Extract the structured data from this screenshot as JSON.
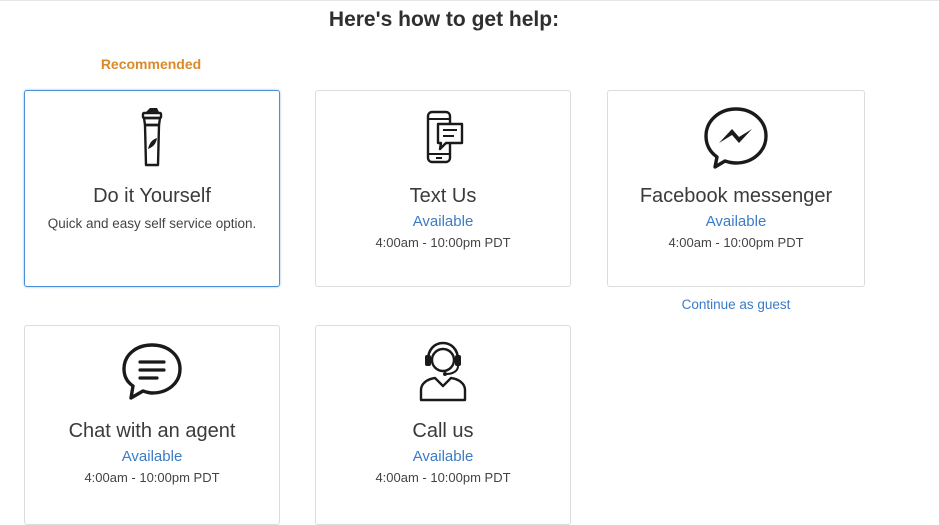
{
  "page": {
    "heading": "Here's how to get help:",
    "recommended_label": "Recommended"
  },
  "options": [
    {
      "title": "Do it Yourself",
      "description": "Quick and easy self service option.",
      "icon": "shaker-bottle-icon"
    },
    {
      "title": "Text Us",
      "status": "Available",
      "hours": "4:00am - 10:00pm PDT",
      "icon": "phone-message-icon"
    },
    {
      "title": "Facebook messenger",
      "status": "Available",
      "hours": "4:00am - 10:00pm PDT",
      "icon": "messenger-icon",
      "link": "Continue as guest"
    },
    {
      "title": "Chat with an agent",
      "status": "Available",
      "hours": "4:00am - 10:00pm PDT",
      "icon": "chat-bubble-icon"
    },
    {
      "title": "Call us",
      "status": "Available",
      "hours": "4:00am - 10:00pm PDT",
      "icon": "headset-agent-icon"
    }
  ],
  "colors": {
    "accent_blue": "#3a7bc8",
    "recommended_orange": "#d98a2b",
    "selected_border": "#4a90d9"
  }
}
